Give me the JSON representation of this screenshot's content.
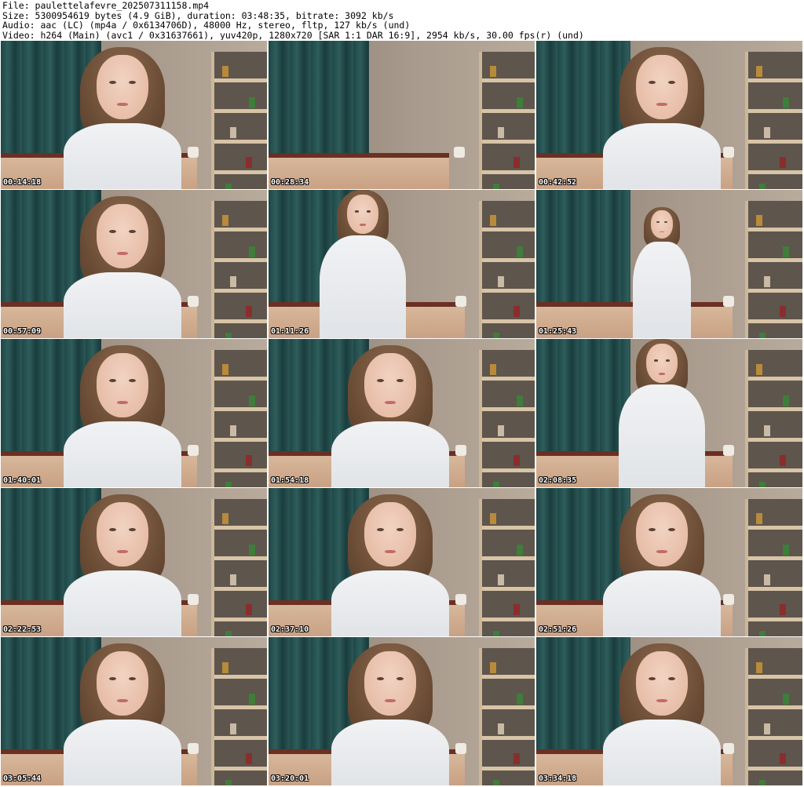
{
  "header": {
    "file_line": "File: paulettelafevre_202507311158.mp4",
    "size_line": "Size: 5300954619 bytes (4.9 GiB), duration: 03:48:35, bitrate: 3092 kb/s",
    "audio_line": "Audio: aac (LC) (mp4a / 0x6134706D), 48000 Hz, stereo, fltp, 127 kb/s (und)",
    "video_line": "Video: h264 (Main) (avc1 / 0x31637661), yuv420p, 1280x720 [SAR 1:1 DAR 16:9], 2954 kb/s, 30.00 fps(r) (und)"
  },
  "thumbnails": [
    {
      "timestamp": "00:14:18",
      "scene": "portrait"
    },
    {
      "timestamp": "00:28:34",
      "scene": "empty-bed"
    },
    {
      "timestamp": "00:42:52",
      "scene": "portrait"
    },
    {
      "timestamp": "00:57:09",
      "scene": "portrait"
    },
    {
      "timestamp": "01:11:26",
      "scene": "standing"
    },
    {
      "timestamp": "01:25:43",
      "scene": "standing-far"
    },
    {
      "timestamp": "01:40:01",
      "scene": "portrait"
    },
    {
      "timestamp": "01:54:18",
      "scene": "portrait"
    },
    {
      "timestamp": "02:08:35",
      "scene": "standing"
    },
    {
      "timestamp": "02:22:53",
      "scene": "portrait"
    },
    {
      "timestamp": "02:37:10",
      "scene": "portrait"
    },
    {
      "timestamp": "02:51:26",
      "scene": "portrait"
    },
    {
      "timestamp": "03:05:44",
      "scene": "portrait"
    },
    {
      "timestamp": "03:20:01",
      "scene": "portrait"
    },
    {
      "timestamp": "03:34:18",
      "scene": "portrait"
    }
  ]
}
